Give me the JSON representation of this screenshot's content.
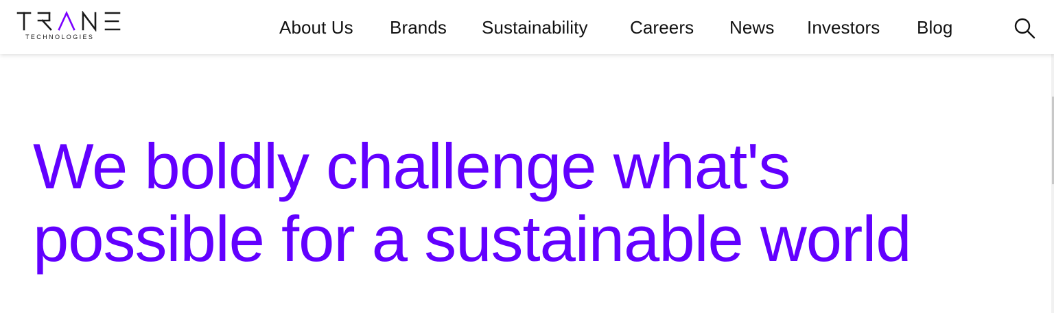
{
  "brand": {
    "name": "TRANE",
    "sub": "TECHNOLOGIES"
  },
  "nav": {
    "items": [
      {
        "label": "About Us"
      },
      {
        "label": "Brands"
      },
      {
        "label": "Sustainability"
      },
      {
        "label": "Careers"
      },
      {
        "label": "News"
      },
      {
        "label": "Investors"
      },
      {
        "label": "Blog"
      }
    ],
    "search_icon": "search-icon"
  },
  "hero": {
    "line1": "We boldly challenge what's",
    "line2": "possible for a sustainable world",
    "color": "#6200ff"
  },
  "colors": {
    "accent": "#6200ff",
    "logo_accent": "#7a00ff",
    "text": "#111111"
  }
}
